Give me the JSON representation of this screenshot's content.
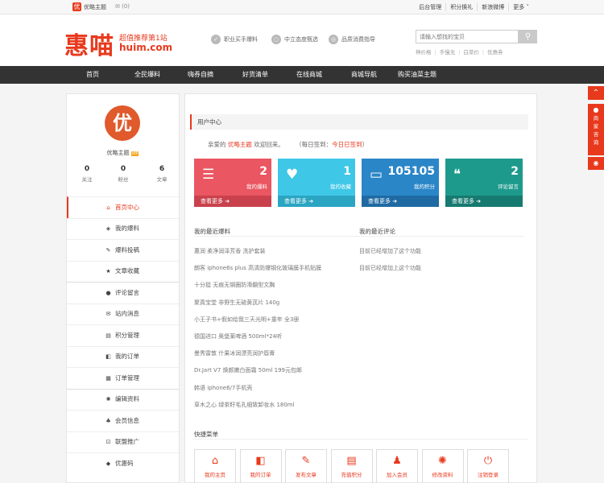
{
  "topbar": {
    "site_name": "优略主题",
    "mail": "✉ (0)",
    "links": [
      "后台管理",
      "积分换礼",
      "新浪微博",
      "更多 ˅"
    ]
  },
  "header": {
    "logo_text": "惠喵",
    "slogan": "超值推荐第1站",
    "url": "huim.com",
    "features": [
      {
        "icon": "thumb-icon",
        "label": "职业买手爆料"
      },
      {
        "icon": "globe-icon",
        "label": "中立态度甄选"
      },
      {
        "icon": "medal-icon",
        "label": "品质消费指导"
      }
    ],
    "search_placeholder": "请输入想找的宝贝",
    "hot_words": [
      "神价格",
      "手慢无",
      "白菜价",
      "优惠券"
    ]
  },
  "nav": [
    "首页",
    "全民爆料",
    "嗨券自摘",
    "好货清单",
    "在线商城",
    "商城导航",
    "购买油菜主题"
  ],
  "user": {
    "avatar_char": "优",
    "name": "优略主题",
    "vip": "VIP",
    "stats": [
      {
        "value": "0",
        "label": "关注"
      },
      {
        "value": "0",
        "label": "粉丝"
      },
      {
        "value": "6",
        "label": "文章"
      }
    ]
  },
  "menu": [
    {
      "icon": "home-icon",
      "glyph": "⌂",
      "label": "首页中心",
      "active": true
    },
    {
      "icon": "cube-icon",
      "glyph": "◈",
      "label": "我的爆料"
    },
    {
      "icon": "edit-icon",
      "glyph": "✎",
      "label": "爆料投稿"
    },
    {
      "icon": "star-icon",
      "glyph": "★",
      "label": "文章收藏"
    },
    {
      "icon": "comment-icon",
      "glyph": "●",
      "label": "评论留言"
    },
    {
      "icon": "envelope-icon",
      "glyph": "✉",
      "label": "站内消息"
    },
    {
      "icon": "card-icon",
      "glyph": "▤",
      "label": "积分管理"
    },
    {
      "icon": "cart-icon",
      "glyph": "◧",
      "label": "我的订单"
    },
    {
      "icon": "list-icon",
      "glyph": "▦",
      "label": "订单管理"
    },
    {
      "icon": "gear-icon",
      "glyph": "✺",
      "label": "编辑资料"
    },
    {
      "icon": "users-icon",
      "glyph": "♣",
      "label": "会员信息"
    },
    {
      "icon": "share-icon",
      "glyph": "⊡",
      "label": "联盟推广"
    },
    {
      "icon": "tag-icon",
      "glyph": "◆",
      "label": "优惠码"
    }
  ],
  "main": {
    "title": "用户中心",
    "welcome": {
      "pre": "亲爱的 ",
      "name": "优略主题",
      "post": " 欢迎回来。",
      "sign_pre": "（每日签到：",
      "sign_link": "今日已签到",
      "sign_post": "）"
    },
    "cards": [
      {
        "icon": "server-icon",
        "glyph": "☰",
        "value": "2",
        "label": "我的爆料",
        "more": "查看更多 ➜",
        "color": "#ea5661",
        "dark": "#c9414c"
      },
      {
        "icon": "heart-icon",
        "glyph": "♥",
        "value": "1",
        "label": "我的收藏",
        "more": "查看更多 ➜",
        "color": "#3fc7e7",
        "dark": "#2aa5c2"
      },
      {
        "icon": "credit-card-icon",
        "glyph": "▭",
        "value": "105105",
        "label": "我的积分",
        "more": "查看更多 ➜",
        "color": "#2b86c8",
        "dark": "#1f6aa3"
      },
      {
        "icon": "chat-icon",
        "glyph": "❝",
        "value": "2",
        "label": "评论留言",
        "more": "查看更多 ➜",
        "color": "#1e9a8d",
        "dark": "#167a70"
      }
    ],
    "recent_posts_title": "我的最近爆料",
    "recent_posts": [
      "惠润 柔净润泽芳香 洗护套装",
      "朗客 iphone6s plus 高清防爆钢化玻璃膜手机贴膜",
      "十分挺 无痕无钢圈防滑翻型文胸",
      "聚真宝堂 非野生无硫黄芪片 140g",
      "小王子书+假如给我三天光明+童年 全3册",
      "德国进口 奥堡莱啤酒 500ml*24听",
      "曼秀雷敦 什果冰润漂亮润护唇膏",
      "Dr.Jart V7 焕颜嫩白面霜 50ml 199元包邮",
      "韩语 iphone6/7手机壳",
      "草木之心 绿茶籽毛孔细致卸妆水 180ml"
    ],
    "recent_comments_title": "我的最近评论",
    "recent_comments": [
      "目前已经增加了这个功能",
      "目前已经增加上这个功能"
    ],
    "quick_title": "快捷菜单",
    "quick": [
      {
        "icon": "home-icon",
        "glyph": "⌂",
        "label": "我的主页"
      },
      {
        "icon": "cart-icon",
        "glyph": "◧",
        "label": "我的订单"
      },
      {
        "icon": "edit-icon",
        "glyph": "✎",
        "label": "发布文章"
      },
      {
        "icon": "card-icon",
        "glyph": "▤",
        "label": "充值积分"
      },
      {
        "icon": "user-icon",
        "glyph": "♟",
        "label": "加入会员"
      },
      {
        "icon": "gear-icon",
        "glyph": "✺",
        "label": "修改资料"
      },
      {
        "icon": "power-icon",
        "glyph": "⏻",
        "label": "注销登录"
      }
    ]
  },
  "float": {
    "up": "⌃",
    "qq_label": "商家咨询",
    "eye": "◉"
  }
}
